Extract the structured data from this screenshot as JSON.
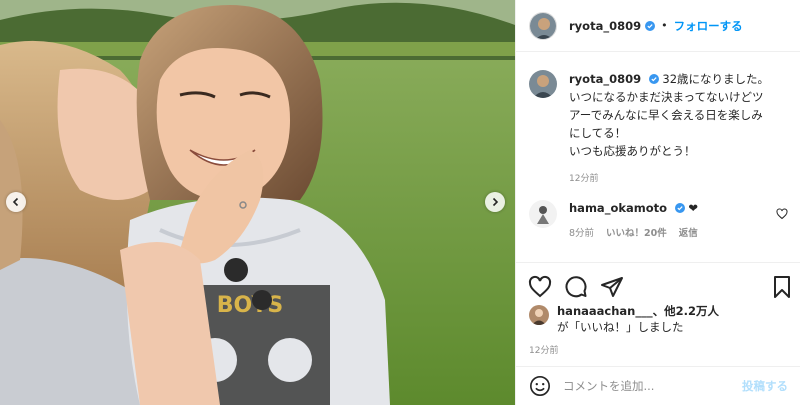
{
  "header": {
    "username": "ryota_0809",
    "separator": "•",
    "follow_label": "フォローする"
  },
  "caption": {
    "username": "ryota_0809",
    "lines": [
      "32歳になりました。",
      "いつになるかまだ決まってないけどツ",
      "アーでみんなに早く会える日を楽しみ",
      "にしてる！",
      "いつも応援ありがとう！"
    ],
    "time": "12分前"
  },
  "comment": {
    "username": "hama_okamoto",
    "text": "❤",
    "time": "8分前",
    "likes": "いいね！20件",
    "reply_label": "返信"
  },
  "likes": {
    "first_user": "hanaaachan___",
    "others": "、他2.2万人",
    "suffix": "が「いいね！」しました"
  },
  "post_time": "12分前",
  "comment_input": {
    "placeholder": "コメントを追加...",
    "post_label": "投稿する"
  },
  "photo": {
    "shirt_text": "BOYS"
  },
  "colors": {
    "accent": "#0095f6",
    "verified": "#3897f0",
    "post_disabled": "#b2dffc"
  }
}
